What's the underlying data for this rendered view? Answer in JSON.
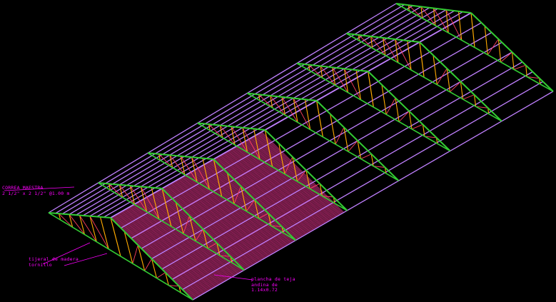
{
  "annotations": {
    "purlin": {
      "line1": "CORREA MAESTRA",
      "line2": "2 1/2\" x 2 1/2\" @1.00 m"
    },
    "truss": {
      "line1": "tijeral de madera",
      "line2": "tornillo"
    },
    "panel": {
      "line1": "plancha de teja",
      "line2": "andina de",
      "line3": "1.14x0.72"
    }
  },
  "colors": {
    "background": "#000000",
    "purlin": "#c080ff",
    "truss": "#33cc33",
    "web_vertical": "#ffaa00",
    "web_diagonal": "#ff4060",
    "sheet_hatch": "#aa2266",
    "sheet_dark": "#661a40",
    "annotation": "#ff00ff"
  }
}
